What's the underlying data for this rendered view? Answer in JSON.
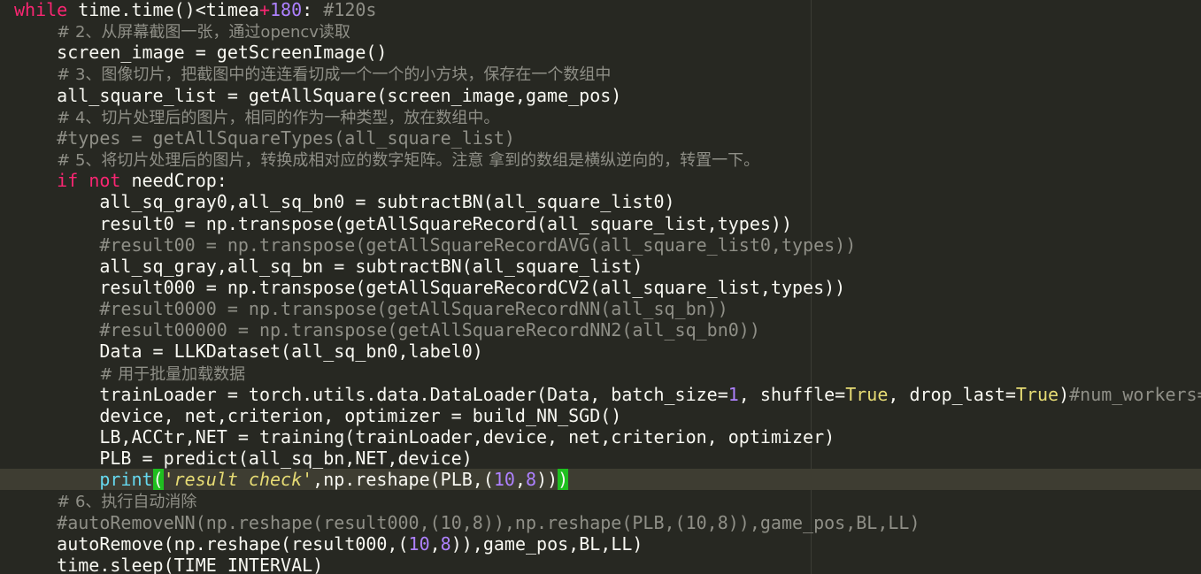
{
  "editor": {
    "lines": [
      [
        {
          "t": "kw",
          "s": "while"
        },
        {
          "t": "",
          "s": " time.time()<timea"
        },
        {
          "t": "kw",
          "s": "+"
        },
        {
          "t": "num",
          "s": "180"
        },
        {
          "t": "",
          "s": ": "
        },
        {
          "t": "cm",
          "s": "#120s"
        }
      ],
      [
        {
          "t": "",
          "s": "    "
        },
        {
          "t": "cm",
          "s": "# 2、从屏幕截图一张，通过opencv读取"
        }
      ],
      [
        {
          "t": "",
          "s": "    screen_image = getScreenImage()"
        }
      ],
      [
        {
          "t": "",
          "s": "    "
        },
        {
          "t": "cm",
          "s": "# 3、图像切片，把截图中的连连看切成一个一个的小方块，保存在一个数组中"
        }
      ],
      [
        {
          "t": "",
          "s": "    all_square_list = getAllSquare(screen_image,game_pos)"
        }
      ],
      [
        {
          "t": "",
          "s": "    "
        },
        {
          "t": "cm",
          "s": "# 4、切片处理后的图片，相同的作为一种类型，放在数组中。"
        }
      ],
      [
        {
          "t": "",
          "s": "    "
        },
        {
          "t": "cm",
          "s": "#types = getAllSquareTypes(all_square_list)"
        }
      ],
      [
        {
          "t": "",
          "s": "    "
        },
        {
          "t": "cm",
          "s": "# 5、将切片处理后的图片，转换成相对应的数字矩阵。注意 拿到的数组是横纵逆向的，转置一下。"
        }
      ],
      [
        {
          "t": "",
          "s": "    "
        },
        {
          "t": "kw",
          "s": "if"
        },
        {
          "t": "",
          "s": " "
        },
        {
          "t": "kw",
          "s": "not"
        },
        {
          "t": "",
          "s": " needCrop:"
        }
      ],
      [
        {
          "t": "",
          "s": "        all_sq_gray0,all_sq_bn0 = subtractBN(all_square_list0)"
        }
      ],
      [
        {
          "t": "",
          "s": "        result0 = np.transpose(getAllSquareRecord(all_square_list,types))"
        }
      ],
      [
        {
          "t": "",
          "s": "        "
        },
        {
          "t": "cm",
          "s": "#result00 = np.transpose(getAllSquareRecordAVG(all_square_list0,types))"
        }
      ],
      [
        {
          "t": "",
          "s": "        all_sq_gray,all_sq_bn = subtractBN(all_square_list)"
        }
      ],
      [
        {
          "t": "",
          "s": "        result000 = np.transpose(getAllSquareRecordCV2(all_square_list,types))"
        }
      ],
      [
        {
          "t": "",
          "s": "        "
        },
        {
          "t": "cm",
          "s": "#result0000 = np.transpose(getAllSquareRecordNN(all_sq_bn))"
        }
      ],
      [
        {
          "t": "",
          "s": "        "
        },
        {
          "t": "cm",
          "s": "#result00000 = np.transpose(getAllSquareRecordNN2(all_sq_bn0))"
        }
      ],
      [
        {
          "t": "",
          "s": "        Data = LLKDataset(all_sq_bn0,label0)"
        }
      ],
      [
        {
          "t": "",
          "s": "        "
        },
        {
          "t": "cm",
          "s": "# 用于批量加载数据"
        }
      ],
      [
        {
          "t": "",
          "s": "        trainLoader = torch.utils.data.DataLoader(Data, batch_size="
        },
        {
          "t": "num",
          "s": "1"
        },
        {
          "t": "",
          "s": ", shuffle="
        },
        {
          "t": "const",
          "s": "True"
        },
        {
          "t": "",
          "s": ", drop_last="
        },
        {
          "t": "const",
          "s": "True"
        },
        {
          "t": "",
          "s": ")"
        },
        {
          "t": "cm",
          "s": "#num_workers="
        }
      ],
      [
        {
          "t": "",
          "s": "        device, net,criterion, optimizer = build_NN_SGD()"
        }
      ],
      [
        {
          "t": "",
          "s": "        LB,ACCtr,NET = training(trainLoader,device, net,criterion, optimizer)"
        }
      ],
      [
        {
          "t": "",
          "s": "        PLB = predict(all_sq_bn,NET,device)"
        }
      ],
      [
        {
          "t": "",
          "s": "        "
        },
        {
          "t": "fn",
          "s": "print"
        },
        {
          "t": "hl",
          "s": "("
        },
        {
          "t": "str",
          "s": "'result check'"
        },
        {
          "t": "",
          "s": ",np.reshape(PLB,("
        },
        {
          "t": "num",
          "s": "10"
        },
        {
          "t": "",
          "s": ","
        },
        {
          "t": "num",
          "s": "8"
        },
        {
          "t": "",
          "s": "))"
        },
        {
          "t": "hl",
          "s": ")"
        }
      ],
      [
        {
          "t": "",
          "s": "    "
        },
        {
          "t": "cm",
          "s": "# 6、执行自动消除"
        }
      ],
      [
        {
          "t": "",
          "s": "    "
        },
        {
          "t": "cm",
          "s": "#autoRemoveNN(np.reshape(result000,(10,8)),np.reshape(PLB,(10,8)),game_pos,BL,LL)"
        }
      ],
      [
        {
          "t": "",
          "s": "    autoRemove(np.reshape(result000,("
        },
        {
          "t": "num",
          "s": "10"
        },
        {
          "t": "",
          "s": ","
        },
        {
          "t": "num",
          "s": "8"
        },
        {
          "t": "",
          "s": ")),game_pos,BL,LL)"
        }
      ],
      [
        {
          "t": "",
          "s": "    time.sleep(TIME_INTERVAL)"
        }
      ]
    ]
  }
}
